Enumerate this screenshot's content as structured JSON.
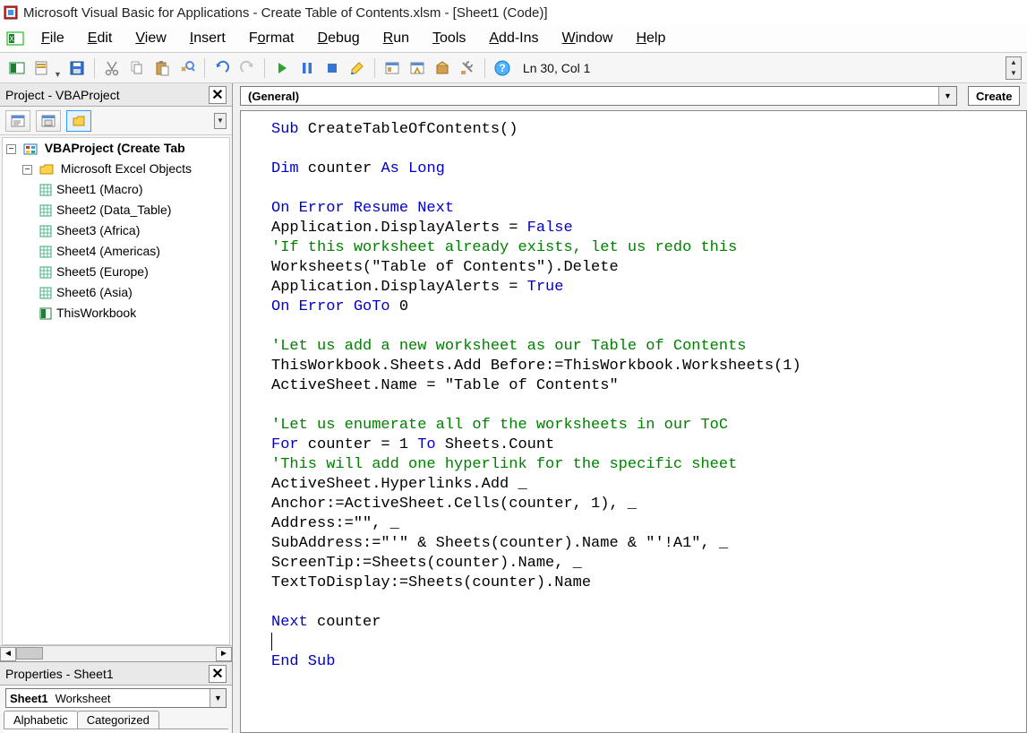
{
  "title": "Microsoft Visual Basic for Applications - Create Table of Contents.xlsm - [Sheet1 (Code)]",
  "menu": {
    "file": "File",
    "edit": "Edit",
    "view": "View",
    "insert": "Insert",
    "format": "Format",
    "debug": "Debug",
    "run": "Run",
    "tools": "Tools",
    "addins": "Add-Ins",
    "window": "Window",
    "help": "Help"
  },
  "status": {
    "pos": "Ln 30, Col 1"
  },
  "project": {
    "title": "Project - VBAProject",
    "root": "VBAProject (Create Tab",
    "group": "Microsoft Excel Objects",
    "sheets": [
      "Sheet1 (Macro)",
      "Sheet2 (Data_Table)",
      "Sheet3 (Africa)",
      "Sheet4 (Americas)",
      "Sheet5 (Europe)",
      "Sheet6 (Asia)"
    ],
    "workbook": "ThisWorkbook"
  },
  "properties": {
    "title": "Properties - Sheet1",
    "objName": "Sheet1",
    "objType": "Worksheet",
    "tabs": {
      "alpha": "Alphabetic",
      "cat": "Categorized"
    }
  },
  "code": {
    "object": "(General)",
    "proc": "Create",
    "lines": [
      [
        [
          "kw",
          "Sub"
        ],
        [
          "",
          " CreateTableOfContents()"
        ]
      ],
      [
        [
          "",
          ""
        ]
      ],
      [
        [
          "kw",
          "Dim"
        ],
        [
          "",
          " counter "
        ],
        [
          "kw",
          "As Long"
        ]
      ],
      [
        [
          "",
          ""
        ]
      ],
      [
        [
          "kw",
          "On Error Resume Next"
        ]
      ],
      [
        [
          "",
          "Application.DisplayAlerts = "
        ],
        [
          "kw",
          "False"
        ]
      ],
      [
        [
          "cm",
          "'If this worksheet already exists, let us redo this"
        ]
      ],
      [
        [
          "",
          "Worksheets(\"Table of Contents\").Delete"
        ]
      ],
      [
        [
          "",
          "Application.DisplayAlerts = "
        ],
        [
          "kw",
          "True"
        ]
      ],
      [
        [
          "kw",
          "On Error GoTo"
        ],
        [
          "",
          " 0"
        ]
      ],
      [
        [
          "",
          ""
        ]
      ],
      [
        [
          "cm",
          "'Let us add a new worksheet as our Table of Contents"
        ]
      ],
      [
        [
          "",
          "ThisWorkbook.Sheets.Add Before:=ThisWorkbook.Worksheets(1)"
        ]
      ],
      [
        [
          "",
          "ActiveSheet.Name = \"Table of Contents\""
        ]
      ],
      [
        [
          "",
          ""
        ]
      ],
      [
        [
          "cm",
          "'Let us enumerate all of the worksheets in our ToC"
        ]
      ],
      [
        [
          "kw",
          "For"
        ],
        [
          "",
          " counter = 1 "
        ],
        [
          "kw",
          "To"
        ],
        [
          "",
          " Sheets.Count"
        ]
      ],
      [
        [
          "cm",
          "'This will add one hyperlink for the specific sheet"
        ]
      ],
      [
        [
          "",
          "ActiveSheet.Hyperlinks.Add _"
        ]
      ],
      [
        [
          "",
          "Anchor:=ActiveSheet.Cells(counter, 1), _"
        ]
      ],
      [
        [
          "",
          "Address:=\"\", _"
        ]
      ],
      [
        [
          "",
          "SubAddress:=\"'\" & Sheets(counter).Name & \"'!A1\", _"
        ]
      ],
      [
        [
          "",
          "ScreenTip:=Sheets(counter).Name, _"
        ]
      ],
      [
        [
          "",
          "TextToDisplay:=Sheets(counter).Name"
        ]
      ],
      [
        [
          "",
          ""
        ]
      ],
      [
        [
          "kw",
          "Next"
        ],
        [
          "",
          " counter"
        ]
      ],
      [
        [
          "",
          ""
        ]
      ],
      [
        [
          "kw",
          "End Sub"
        ]
      ]
    ]
  }
}
